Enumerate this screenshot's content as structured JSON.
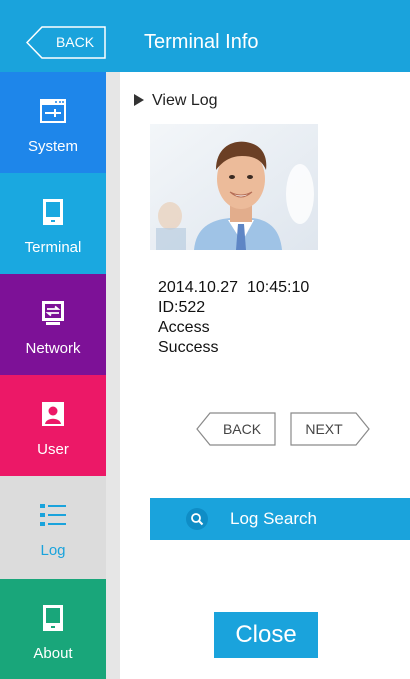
{
  "header": {
    "back_label": "BACK",
    "title": "Terminal Info"
  },
  "sidebar": {
    "items": [
      {
        "label": "System",
        "icon": "system-icon",
        "color": "#1e86ea"
      },
      {
        "label": "Terminal",
        "icon": "terminal-icon",
        "color": "#1aa8e0"
      },
      {
        "label": "Network",
        "icon": "network-icon",
        "color": "#7d1197"
      },
      {
        "label": "User",
        "icon": "user-icon",
        "color": "#ec1867"
      },
      {
        "label": "Log",
        "icon": "list-icon",
        "color": "#1aa3dc",
        "active": true
      },
      {
        "label": "About",
        "icon": "terminal-icon",
        "color": "#19a67a"
      }
    ]
  },
  "main": {
    "section_title": "View Log",
    "log_entry": {
      "datetime": "2014.10.27  10:45:10",
      "id": "ID:522",
      "type": "Access",
      "result": "Success"
    },
    "pager": {
      "back_label": "BACK",
      "next_label": "NEXT"
    },
    "search_label": "Log Search",
    "close_label": "Close"
  },
  "colors": {
    "accent": "#1aa3dc",
    "active_bg": "#dcdcdc"
  }
}
